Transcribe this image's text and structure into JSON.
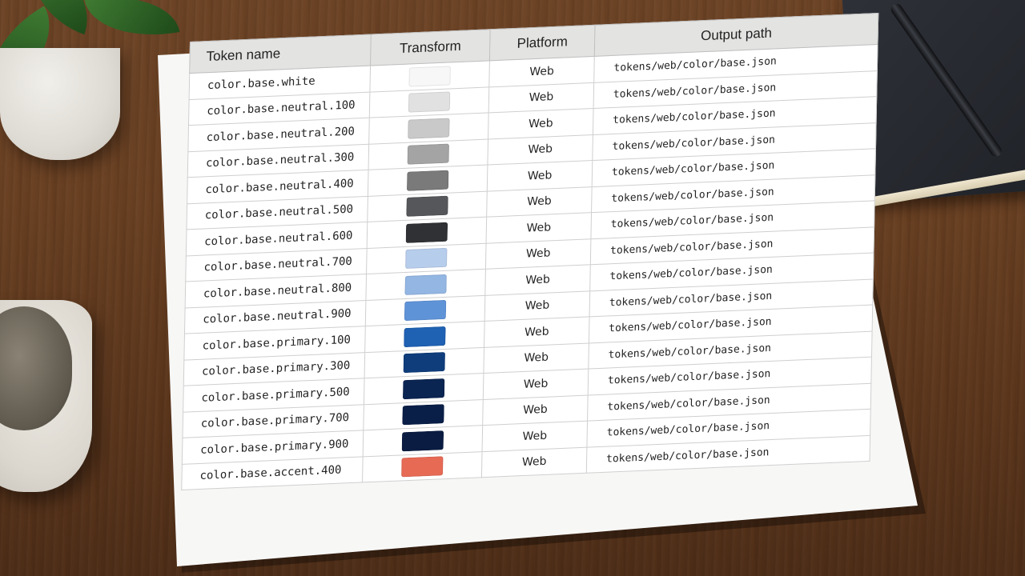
{
  "table": {
    "headers": {
      "token_name": "Token name",
      "transform": "Transform",
      "platform": "Platform",
      "output_path": "Output path"
    },
    "rows": [
      {
        "token": "color.base.white",
        "swatch": "#f7f7f7",
        "platform": "Web",
        "path": "tokens/web/color/base.json"
      },
      {
        "token": "color.base.neutral.100",
        "swatch": "#e1e1e1",
        "platform": "Web",
        "path": "tokens/web/color/base.json"
      },
      {
        "token": "color.base.neutral.200",
        "swatch": "#c9c9c9",
        "platform": "Web",
        "path": "tokens/web/color/base.json"
      },
      {
        "token": "color.base.neutral.300",
        "swatch": "#a4a4a4",
        "platform": "Web",
        "path": "tokens/web/color/base.json"
      },
      {
        "token": "color.base.neutral.400",
        "swatch": "#7a7a7a",
        "platform": "Web",
        "path": "tokens/web/color/base.json"
      },
      {
        "token": "color.base.neutral.500",
        "swatch": "#55575a",
        "platform": "Web",
        "path": "tokens/web/color/base.json"
      },
      {
        "token": "color.base.neutral.600",
        "swatch": "#2f3134",
        "platform": "Web",
        "path": "tokens/web/color/base.json"
      },
      {
        "token": "color.base.neutral.700",
        "swatch": "#b7cdec",
        "platform": "Web",
        "path": "tokens/web/color/base.json"
      },
      {
        "token": "color.base.neutral.800",
        "swatch": "#93b6e3",
        "platform": "Web",
        "path": "tokens/web/color/base.json"
      },
      {
        "token": "color.base.neutral.900",
        "swatch": "#5f93d8",
        "platform": "Web",
        "path": "tokens/web/color/base.json"
      },
      {
        "token": "color.base.primary.100",
        "swatch": "#1f61b3",
        "platform": "Web",
        "path": "tokens/web/color/base.json"
      },
      {
        "token": "color.base.primary.300",
        "swatch": "#0f3d7c",
        "platform": "Web",
        "path": "tokens/web/color/base.json"
      },
      {
        "token": "color.base.primary.500",
        "swatch": "#0b2552",
        "platform": "Web",
        "path": "tokens/web/color/base.json"
      },
      {
        "token": "color.base.primary.700",
        "swatch": "#0a1f48",
        "platform": "Web",
        "path": "tokens/web/color/base.json"
      },
      {
        "token": "color.base.primary.900",
        "swatch": "#0a1c42",
        "platform": "Web",
        "path": "tokens/web/color/base.json"
      },
      {
        "token": "color.base.accent.400",
        "swatch": "#e76a55",
        "platform": "Web",
        "path": "tokens/web/color/base.json"
      }
    ]
  },
  "colors": {
    "desk": "#6a4123",
    "paper": "#f7f7f6",
    "header_bg": "#e3e3e2"
  }
}
